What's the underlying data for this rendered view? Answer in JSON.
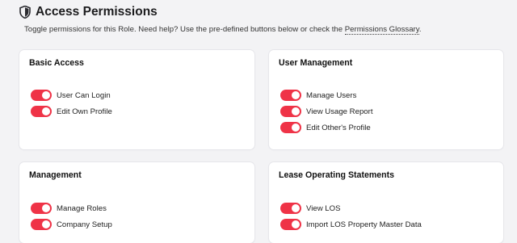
{
  "header": {
    "title": "Access Permissions",
    "icon": "shield-icon",
    "subtitle_prefix": "Toggle permissions for this Role. Need help? Use the pre-defined buttons below or check the ",
    "glossary_link": "Permissions Glossary",
    "subtitle_suffix": "."
  },
  "colors": {
    "toggle_on": "#ef3347",
    "background": "#f3f3f5",
    "card": "#ffffff"
  },
  "cards": [
    {
      "title": "Basic Access",
      "permissions": [
        {
          "label": "User Can Login",
          "enabled": true
        },
        {
          "label": "Edit Own Profile",
          "enabled": true
        }
      ]
    },
    {
      "title": "User Management",
      "permissions": [
        {
          "label": "Manage Users",
          "enabled": true
        },
        {
          "label": "View Usage Report",
          "enabled": true
        },
        {
          "label": "Edit Other's Profile",
          "enabled": true
        }
      ]
    },
    {
      "title": "Management",
      "permissions": [
        {
          "label": "Manage Roles",
          "enabled": true
        },
        {
          "label": "Company Setup",
          "enabled": true
        }
      ]
    },
    {
      "title": "Lease Operating Statements",
      "permissions": [
        {
          "label": "View LOS",
          "enabled": true
        },
        {
          "label": "Import LOS Property Master Data",
          "enabled": true
        }
      ]
    }
  ]
}
